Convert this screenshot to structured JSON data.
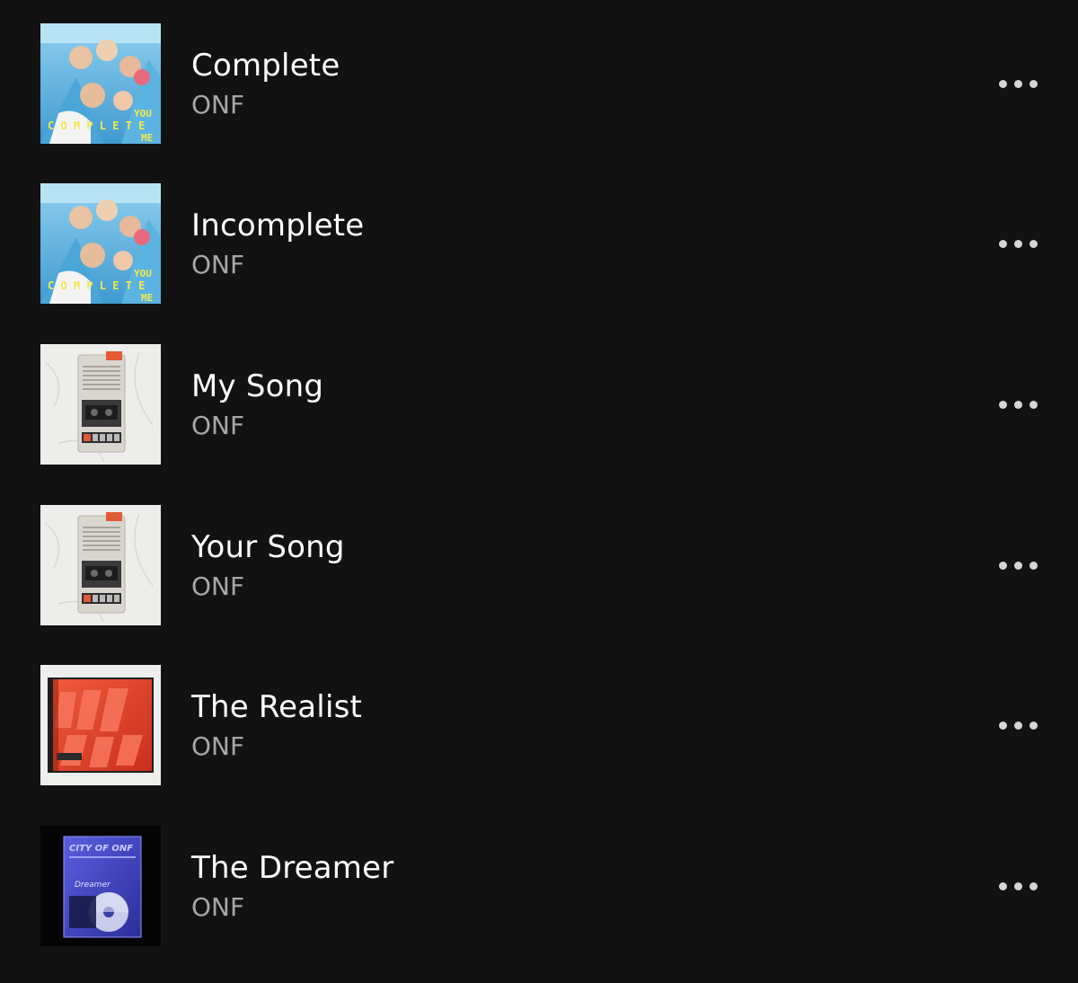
{
  "tracks": [
    {
      "title": "Complete",
      "artist": "ONF",
      "cover": "album-you-complete-me"
    },
    {
      "title": "Incomplete",
      "artist": "ONF",
      "cover": "album-you-complete-me"
    },
    {
      "title": "My Song",
      "artist": "ONF",
      "cover": "album-cassette-player"
    },
    {
      "title": "Your Song",
      "artist": "ONF",
      "cover": "album-cassette-player"
    },
    {
      "title": "The Realist",
      "artist": "ONF",
      "cover": "album-red-myna"
    },
    {
      "title": "The Dreamer",
      "artist": "ONF",
      "cover": "album-city-of-onf"
    }
  ],
  "more_icon": "more-horizontal-icon",
  "colors": {
    "background": "#121212",
    "title": "#ffffff",
    "artist": "#a7a7a7",
    "more_dots": "#d6d6d6"
  }
}
